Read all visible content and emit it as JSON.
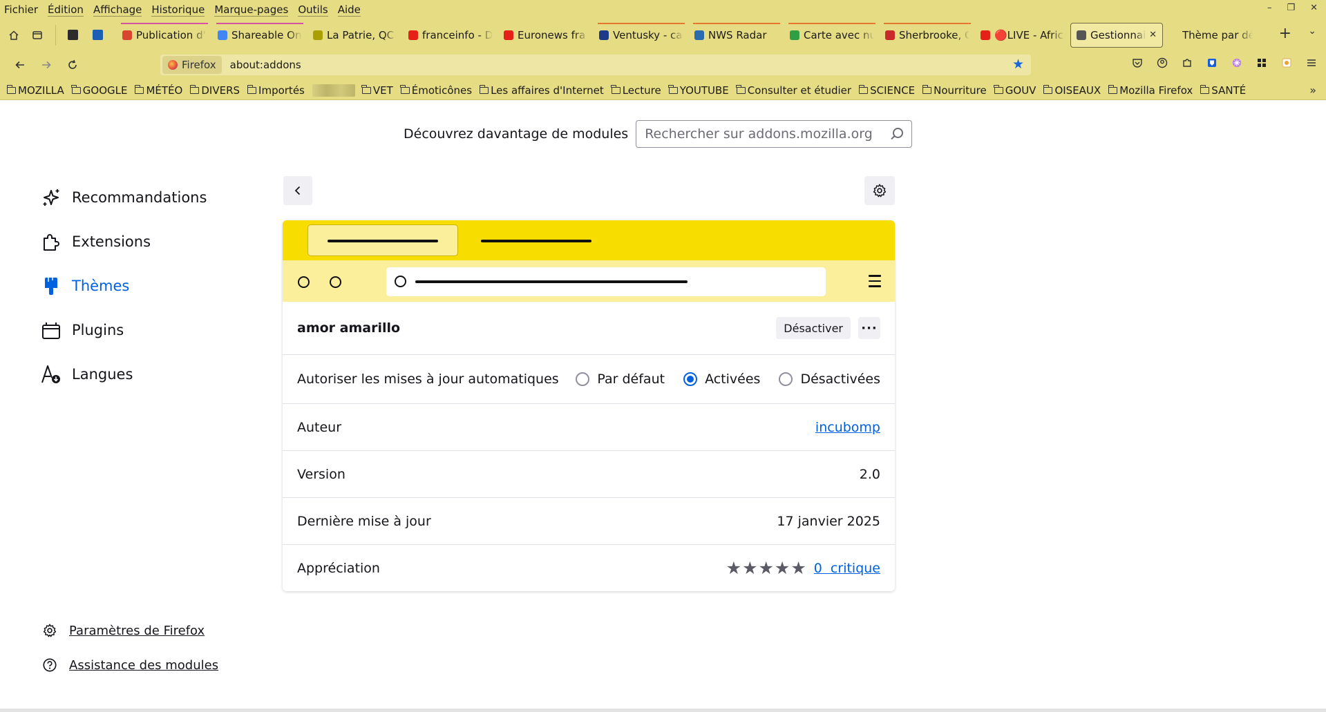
{
  "menubar": {
    "items": [
      "Fichier",
      "Édition",
      "Affichage",
      "Historique",
      "Marque-pages",
      "Outils",
      "Aide"
    ]
  },
  "window_controls": {
    "minimize": "–",
    "restore": "❐",
    "close": "✕"
  },
  "tabs": [
    {
      "label": "Publication d'",
      "fav_color": "#d9462f",
      "accent": "pink"
    },
    {
      "label": "Shareable On",
      "fav_color": "#4285f4",
      "accent": "pink"
    },
    {
      "label": "La Patrie, QC",
      "fav_color": "#a9a000",
      "accent": "none"
    },
    {
      "label": "franceinfo - D",
      "fav_color": "#e62117",
      "accent": "none"
    },
    {
      "label": "Euronews fra",
      "fav_color": "#e62117",
      "accent": "none"
    },
    {
      "label": "Ventusky - ca",
      "fav_color": "#1d3a8a",
      "accent": "orange"
    },
    {
      "label": "NWS Radar",
      "fav_color": "#2b6cb0",
      "accent": "orange"
    },
    {
      "label": "Carte avec nu",
      "fav_color": "#2f9e44",
      "accent": "orange"
    },
    {
      "label": "Sherbrooke, C",
      "fav_color": "#c92a2a",
      "accent": "orange"
    },
    {
      "label": "🔴LIVE - Afric",
      "fav_color": "#e62117",
      "accent": "none"
    },
    {
      "label": "Gestionnaire",
      "fav_color": "#555555",
      "accent": "active",
      "close": "✕"
    },
    {
      "label": "Thème par défa",
      "fav_color": "transparent",
      "accent": "none"
    }
  ],
  "tabbar": {
    "new_tab": "+",
    "list_all": "⌄"
  },
  "urlbar": {
    "identity_label": "Firefox",
    "url": "about:addons"
  },
  "bookmarks": [
    "MOZILLA",
    "GOOGLE",
    "MÉTÉO",
    "DIVERS",
    "Importés",
    "VET",
    "Émoticônes",
    "Les affaires d'Internet",
    "Lecture",
    "YOUTUBE",
    "Consulter et étudier",
    "SCIENCE",
    "Nourriture",
    "GOUV",
    "OISEAUX",
    "Mozilla Firefox",
    "SANTÉ"
  ],
  "bookmarks_overflow": "»",
  "find_more": {
    "label": "Découvrez davantage de modules",
    "placeholder": "Rechercher sur addons.mozilla.org"
  },
  "sidebar": {
    "categories": [
      {
        "label": "Recommandations",
        "icon": "sparkle-icon"
      },
      {
        "label": "Extensions",
        "icon": "puzzle-icon"
      },
      {
        "label": "Thèmes",
        "icon": "brush-icon",
        "selected": true
      },
      {
        "label": "Plugins",
        "icon": "plugin-icon"
      },
      {
        "label": "Langues",
        "icon": "language-icon"
      }
    ],
    "footer": [
      {
        "label": "Paramètres de Firefox",
        "icon": "gear-icon"
      },
      {
        "label": "Assistance des modules",
        "icon": "help-icon"
      }
    ]
  },
  "addon": {
    "name": "amor amarillo",
    "disable_label": "Désactiver",
    "more_label": "···",
    "preview_colors": {
      "frame": "#f7dd00",
      "toolbar": "#fbef9b"
    },
    "auto_update": {
      "label": "Autoriser les mises à jour automatiques",
      "options": [
        {
          "label": "Par défaut",
          "checked": false
        },
        {
          "label": "Activées",
          "checked": true
        },
        {
          "label": "Désactivées",
          "checked": false
        }
      ]
    },
    "author": {
      "label": "Auteur",
      "value": "incubomp"
    },
    "version": {
      "label": "Version",
      "value": "2.0"
    },
    "updated": {
      "label": "Dernière mise à jour",
      "value": "17 janvier 2025"
    },
    "rating": {
      "label": "Appréciation",
      "stars": 5,
      "reviews": "0  critique"
    }
  }
}
